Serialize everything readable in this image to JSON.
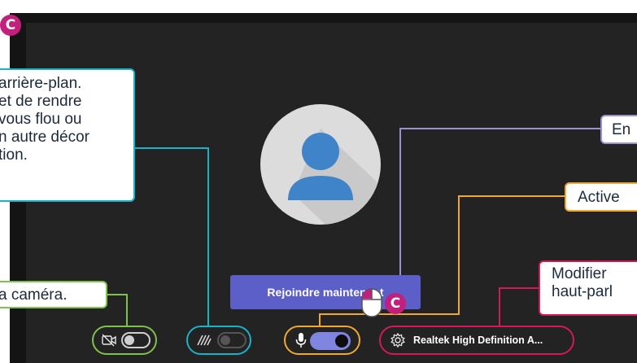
{
  "badges": {
    "letter": "C"
  },
  "preview": {
    "join_button_label": "Rejoindre maintenant"
  },
  "callouts": {
    "background": {
      "line1": "arrière-plan.",
      "line2": "et de rendre",
      "line3": "vous flou ou",
      "line4": "n autre décor",
      "line5": "tion."
    },
    "camera": "a caméra.",
    "en": "En",
    "activate": "Active",
    "modify": {
      "line1": "Modifier",
      "line2": "haut-parl"
    }
  },
  "controls": {
    "camera": {
      "icon": "camera-off-icon",
      "state": "off"
    },
    "background_effects": {
      "icon": "background-blur-icon",
      "state": "disabled"
    },
    "microphone": {
      "icon": "microphone-icon",
      "state": "on"
    },
    "speaker": {
      "icon": "settings-icon",
      "label": "Realtek High Definition A..."
    }
  },
  "colors": {
    "background_callout": "#1ab2c8",
    "camera_callout": "#7dc24b",
    "en_callout": "#9b8fd8",
    "activate_callout": "#f0a830",
    "modify_callout": "#d4185a",
    "badge": "#c2207c",
    "join_button": "#5b5fc7",
    "toggle_on": "#7f86e0"
  }
}
